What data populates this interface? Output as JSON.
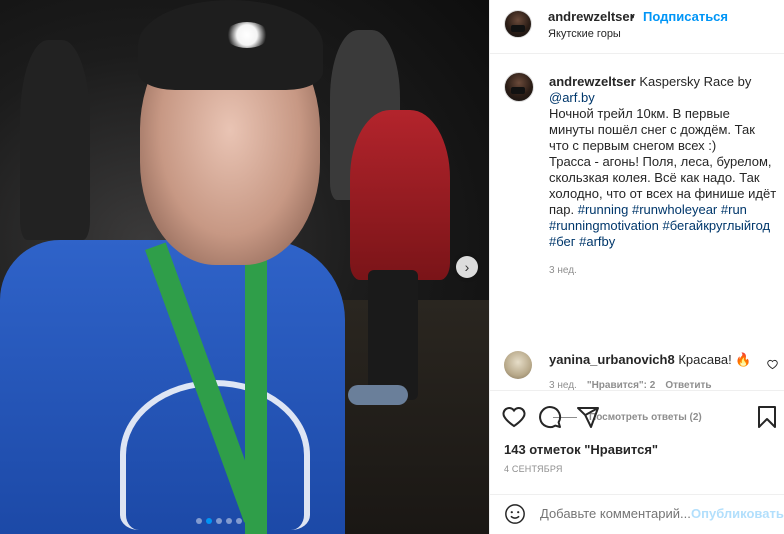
{
  "photo": {
    "alt_icon_next": "chevron-right-icon",
    "carousel": {
      "count": 5,
      "active_index": 1
    },
    "colors": {
      "shirt": "#2f63c9",
      "lanyard": "#2f9e49",
      "jacket": "#b3242c"
    }
  },
  "post": {
    "username": "andrewzeltser",
    "bullet": "•",
    "follow_label": "Подписаться",
    "location": "Якутские горы"
  },
  "caption": {
    "username": "andrewzeltser",
    "lead": "Kaspersky Race by",
    "mention": "@arf.by",
    "paragraph1": "Ночной трейл 10км. В первые минуты пошёл снег с дождём. Так что с первым снегом всех :)",
    "paragraph2": "Трасса - агонь! Поля, леса, бурелом, скользкая колея. Всё как надо. Так холодно, что от всех на финише идёт пар.",
    "hashtags": [
      "#running",
      "#runwholeyear",
      "#run",
      "#runningmotivation",
      "#бегайкруглыйгод",
      "#бег",
      "#arfby"
    ],
    "time": "3 нед."
  },
  "comment": {
    "username": "yanina_urbanovich8",
    "text": "Красава! 🔥",
    "time": "3 нед.",
    "likes_label": "\"Нравится\": 2",
    "reply_label": "Ответить",
    "view_replies": "Посмотреть ответы (2)"
  },
  "actions": {
    "like_icon": "heart-icon",
    "comment_icon": "comment-icon",
    "share_icon": "share-icon",
    "save_icon": "bookmark-icon"
  },
  "likes_text": "143 отметок \"Нравится\"",
  "date_text": "4 СЕНТЯБРЯ",
  "add_comment": {
    "placeholder": "Добавьте комментарий...",
    "publish_label": "Опубликовать"
  }
}
